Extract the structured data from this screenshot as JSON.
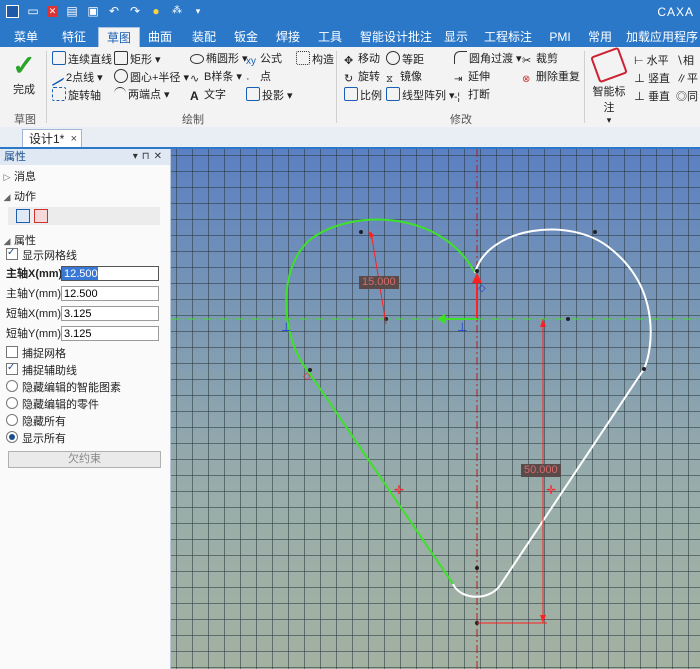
{
  "app": {
    "title": "CAXA",
    "quick_access_icons": [
      "app-logo-icon",
      "new-file-icon",
      "close-file-icon",
      "open-folder-icon",
      "save-icon",
      "undo-icon",
      "redo-icon",
      "design-wizard-icon",
      "settings-icon",
      "dropdown-icon"
    ]
  },
  "tabs": [
    {
      "label": "菜单",
      "active": false
    },
    {
      "label": "特征",
      "active": false
    },
    {
      "label": "草图",
      "active": true
    },
    {
      "label": "曲面",
      "active": false
    },
    {
      "label": "装配",
      "active": false
    },
    {
      "label": "钣金",
      "active": false
    },
    {
      "label": "焊接",
      "active": false
    },
    {
      "label": "工具",
      "active": false
    },
    {
      "label": "智能设计批注",
      "active": false
    },
    {
      "label": "显示",
      "active": false
    },
    {
      "label": "工程标注",
      "active": false
    },
    {
      "label": "PMI",
      "active": false
    },
    {
      "label": "常用",
      "active": false
    },
    {
      "label": "加载应用程序",
      "active": false
    }
  ],
  "ribbon": {
    "finish_label": "完成",
    "sketch_group_label": "草图",
    "draw_group_label": "绘制",
    "modify_group_label": "修改",
    "draw_items": {
      "polyline": "连续直线",
      "two_point_line": "2点线",
      "rotate_axis": "旋转轴",
      "rectangle": "矩形",
      "center_radius": "圆心+半径",
      "two_points": "两端点",
      "ellipse": "椭圆形",
      "bspline": "B样条",
      "text": "文字",
      "formula": "公式",
      "point": "点",
      "projection": "投影",
      "construct": "构造"
    },
    "modify_items": {
      "move": "移动",
      "rotate": "旋转",
      "scale": "比例",
      "offset": "等距",
      "mirror": "镜像",
      "linear_array": "线型阵列",
      "fillet": "圆角过渡",
      "extend": "延伸",
      "break": "打断",
      "trim": "裁剪",
      "delete_duplicate": "删除重复"
    },
    "smart_dim_label": "智能标注",
    "dim_items": {
      "horizontal": "水平",
      "vertical": "竖直",
      "perpendicular": "垂直",
      "tangent": "相",
      "parallel": "平",
      "same": "同"
    }
  },
  "doc_tab": {
    "label": "设计1*",
    "close": "×"
  },
  "panel": {
    "title": "属性",
    "section_message": "消息",
    "section_action": "动作",
    "section_properties": "属性",
    "show_grid_label": "显示网格线",
    "show_grid_checked": true,
    "fields": [
      {
        "label": "主轴X(mm)",
        "value": "12.500",
        "bold": true,
        "selected": true
      },
      {
        "label": "主轴Y(mm)",
        "value": "12.500",
        "bold": false,
        "selected": false
      },
      {
        "label": "短轴X(mm)",
        "value": "3.125",
        "bold": false,
        "selected": false
      },
      {
        "label": "短轴Y(mm)",
        "value": "3.125",
        "bold": false,
        "selected": false
      }
    ],
    "snap_grid_label": "捕捉网格",
    "snap_grid_checked": false,
    "snap_aux_label": "捕捉辅助线",
    "snap_aux_checked": true,
    "radio_options": [
      {
        "label": "隐藏编辑的智能图素",
        "selected": false
      },
      {
        "label": "隐藏编辑的零件",
        "selected": false
      },
      {
        "label": "隐藏所有",
        "selected": false
      },
      {
        "label": "显示所有",
        "selected": true
      }
    ],
    "under_constrained_label": "欠约束"
  },
  "canvas": {
    "dim_radius": "15.000",
    "dim_height": "50.000",
    "colors": {
      "constrained": "#3fe02a",
      "unconstrained": "#ffffff",
      "dimension": "#ff2020",
      "axis": "#b02020"
    }
  }
}
